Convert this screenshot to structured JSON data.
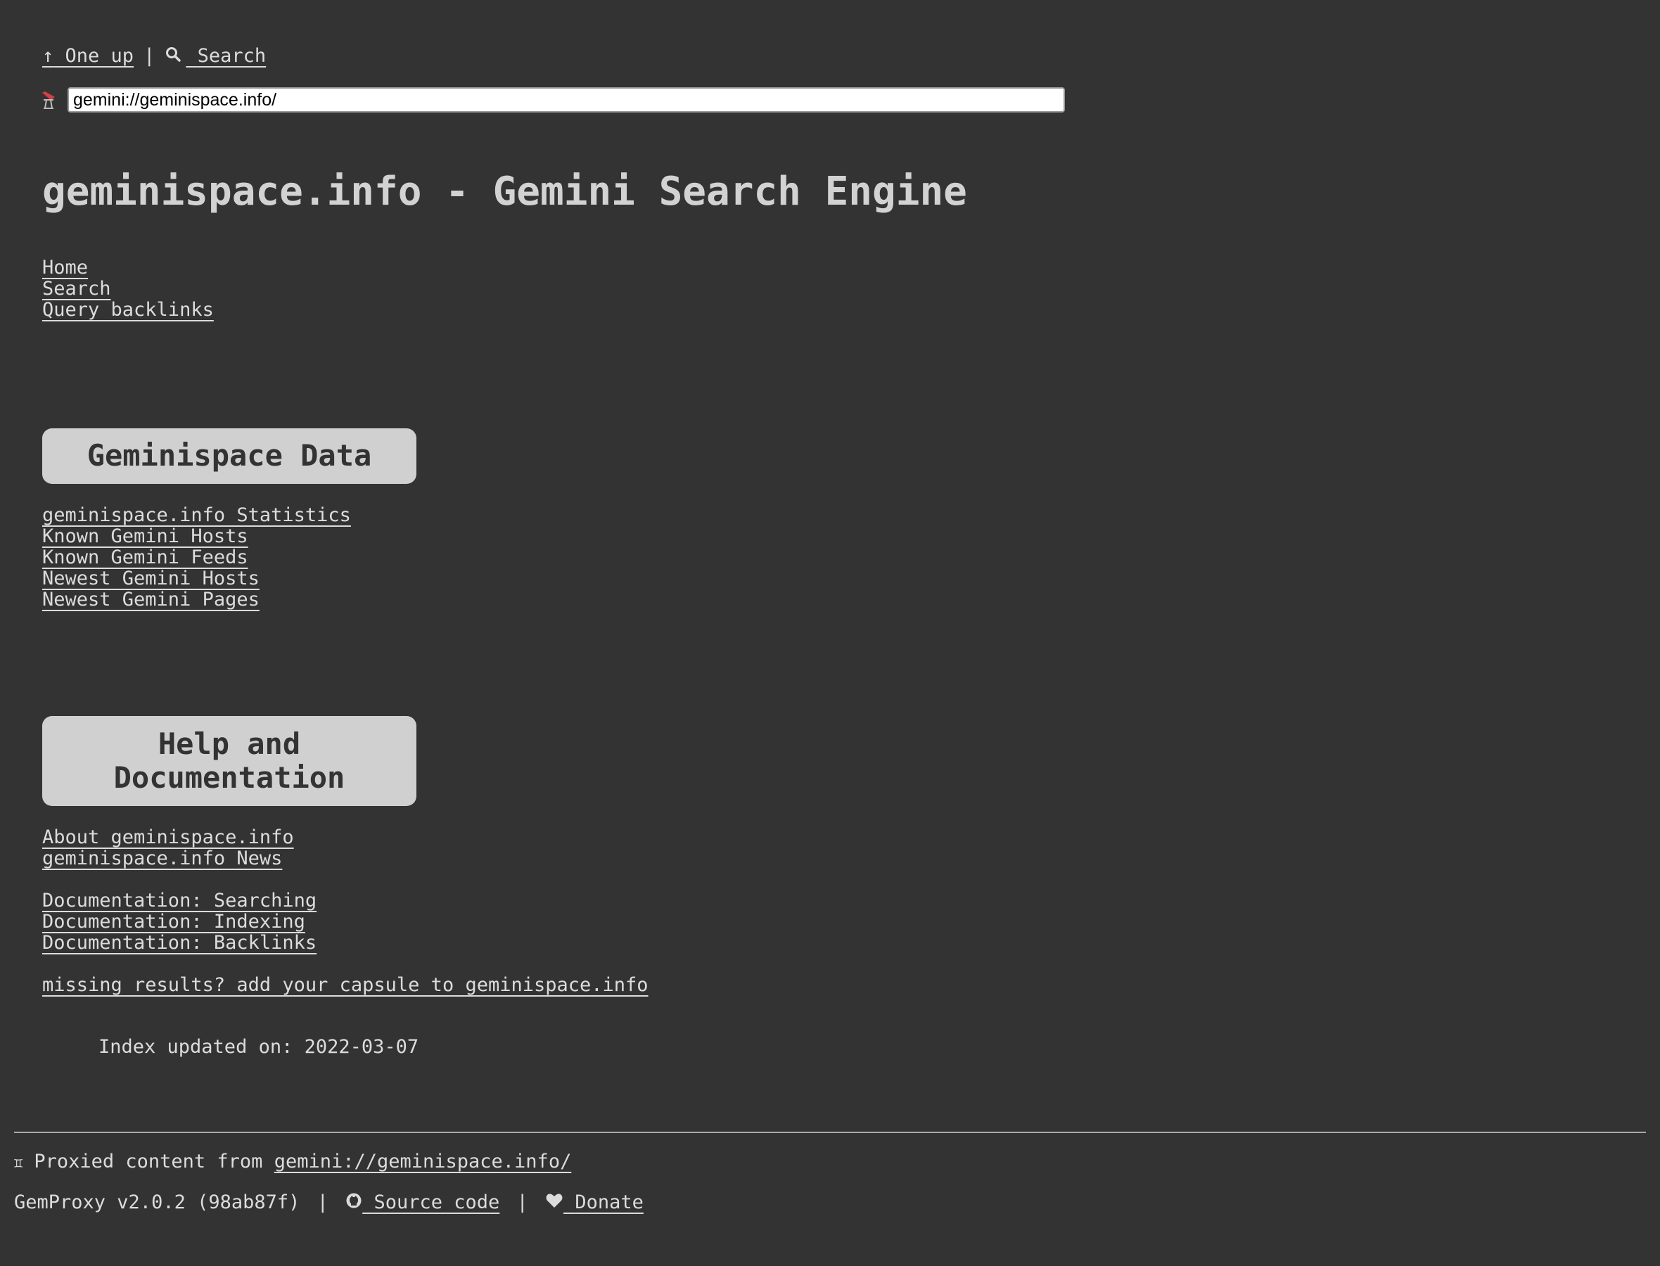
{
  "topnav": {
    "up_arrow": "↑",
    "up_label": "One up",
    "separator": "|",
    "search_label": "Search"
  },
  "url": {
    "value": "gemini://geminispace.info/"
  },
  "page": {
    "title": "geminispace.info - Gemini Search Engine"
  },
  "main_links": [
    {
      "label": "Home"
    },
    {
      "label": "Search"
    },
    {
      "label": "Query backlinks"
    }
  ],
  "data_section": {
    "heading": "Geminispace Data",
    "links": [
      {
        "label": "geminispace.info Statistics"
      },
      {
        "label": "Known Gemini Hosts"
      },
      {
        "label": "Known Gemini Feeds"
      },
      {
        "label": "Newest Gemini Hosts"
      },
      {
        "label": "Newest Gemini Pages"
      }
    ]
  },
  "help_section": {
    "heading_line1": "Help and",
    "heading_line2": "Documentation",
    "links_group1": [
      {
        "label": "About geminispace.info"
      },
      {
        "label": "geminispace.info News"
      }
    ],
    "links_group2": [
      {
        "label": "Documentation: Searching"
      },
      {
        "label": "Documentation: Indexing"
      },
      {
        "label": "Documentation: Backlinks"
      }
    ],
    "missing_link": "missing results? add your capsule to geminispace.info"
  },
  "index_updated": "Index updated on: 2022-03-07",
  "footer": {
    "proxied_prefix": "Proxied content from",
    "proxied_link": "gemini://geminispace.info/",
    "version": "GemProxy v2.0.2 (98ab87f)",
    "sep": "|",
    "source_label": "Source code",
    "donate_label": "Donate"
  },
  "colors": {
    "background": "#333333",
    "text": "#dcdcdc",
    "box_bg": "#d0d0d0",
    "logo_red": "#d33f49"
  }
}
